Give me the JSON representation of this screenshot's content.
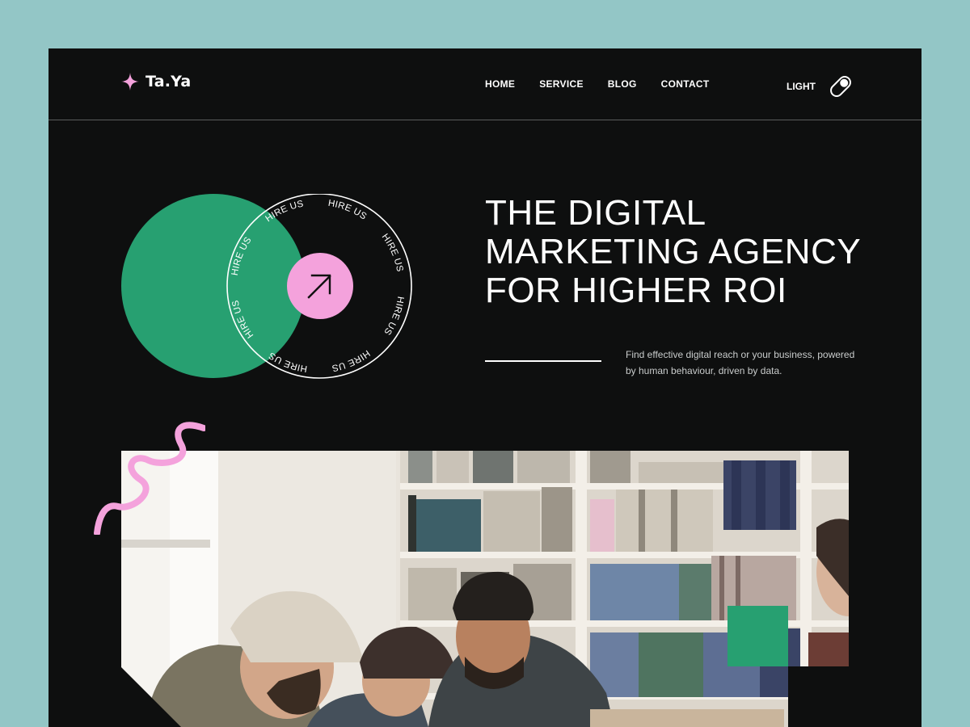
{
  "brand": {
    "name": "Ta.Ya",
    "accent_pink": "#f4a2dc",
    "accent_green": "#27a071",
    "background": "#0e0f0f",
    "page_background": "#93c6c6"
  },
  "nav": {
    "items": [
      "HOME",
      "SERVICE",
      "BLOG",
      "CONTACT"
    ]
  },
  "theme_toggle": {
    "label": "LIGHT"
  },
  "hire_badge": {
    "text": "HIRE US",
    "icon": "arrow-up-right-icon"
  },
  "hero": {
    "title_lines": [
      "THE DIGITAL",
      "MARKETING AGENCY",
      "FOR HIGHER ROI"
    ],
    "description": "Find effective digital reach or your business, powered by human behaviour, driven by data."
  },
  "icons": {
    "logo": "sparkle-icon",
    "toggle": "toggle-icon",
    "squiggle": "squiggle-decoration"
  }
}
